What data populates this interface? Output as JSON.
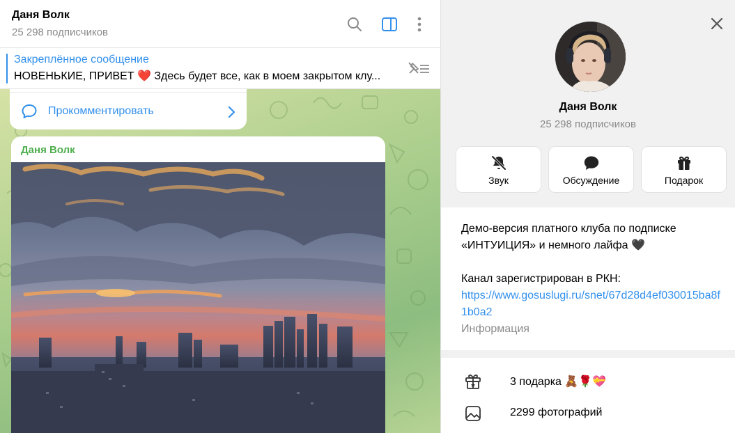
{
  "chat": {
    "title": "Даня Волк",
    "subtitle": "25 298 подписчиков",
    "icons": [
      "search-icon",
      "sidebar-toggle-icon",
      "more-vertical-icon"
    ]
  },
  "pinned": {
    "title": "Закреплённое сообщение",
    "text": "НОВЕНЬКИЕ, ПРИВЕТ ❤️  Здесь будет все, как в моем закрытом клу..."
  },
  "comment": {
    "label": "Прокомментировать"
  },
  "post": {
    "author": "Даня Волк"
  },
  "profile": {
    "name": "Даня Волк",
    "subtitle": "25 298 подписчиков",
    "actions": [
      {
        "label": "Звук",
        "icon": "bell-off-icon"
      },
      {
        "label": "Обсуждение",
        "icon": "chat-bubble-icon"
      },
      {
        "label": "Подарок",
        "icon": "gift-icon"
      }
    ],
    "description_line1": "Демо-версия платного клуба по подписке",
    "description_line2": "«ИНТУИЦИЯ» и немного лайфа 🖤",
    "description_line3": "Канал зарегистрирован в РКН:",
    "link": "https://www.gosuslugi.ru/snet/67d28d4ef030015ba8f1b0a2",
    "caption": "Информация",
    "list": [
      {
        "label": "3 подарка 🧸🌹💝",
        "icon": "gift-outline-icon"
      },
      {
        "label": "2299 фотографий",
        "icon": "photo-icon"
      }
    ]
  },
  "colors": {
    "accent": "#3390ec",
    "author": "#4fae4e",
    "muted": "#8a8a8a"
  }
}
